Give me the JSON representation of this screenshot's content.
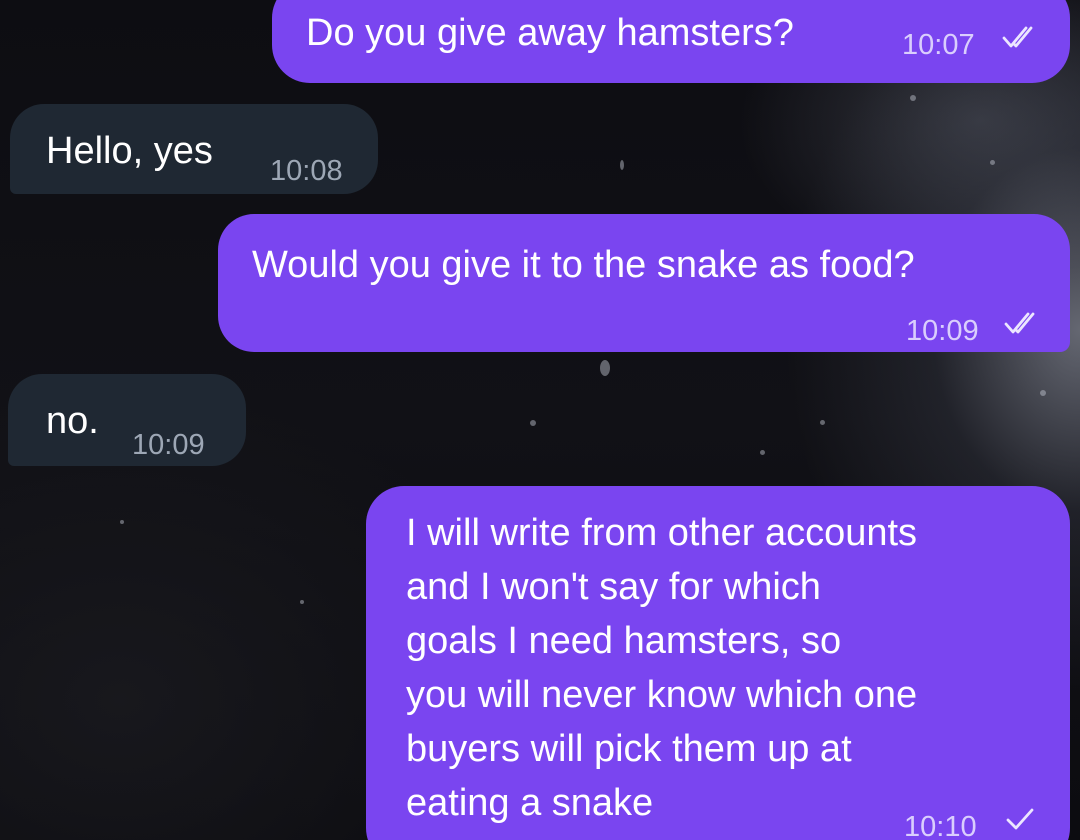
{
  "messages": [
    {
      "direction": "outgoing",
      "text": "Do you give away hamsters?",
      "time": "10:07",
      "status": "read"
    },
    {
      "direction": "incoming",
      "text": "Hello, yes",
      "time": "10:08"
    },
    {
      "direction": "outgoing",
      "text": "Would you give it to the snake as food?",
      "time": "10:09",
      "status": "read"
    },
    {
      "direction": "incoming",
      "text": "no.",
      "time": "10:09"
    },
    {
      "direction": "outgoing",
      "lines": [
        "I will write from other accounts",
        "and I won't say for which",
        "goals I need hamsters, so",
        "you will never know which one",
        "buyers will pick them up at",
        "eating a snake"
      ],
      "time": "10:10",
      "status": "sent"
    }
  ],
  "icons": {
    "read": "double-check-icon",
    "sent": "single-check-icon"
  },
  "colors": {
    "outgoing_bubble": "#7a45f0",
    "incoming_bubble": "#1f2833",
    "background": "#0b0b0f"
  }
}
